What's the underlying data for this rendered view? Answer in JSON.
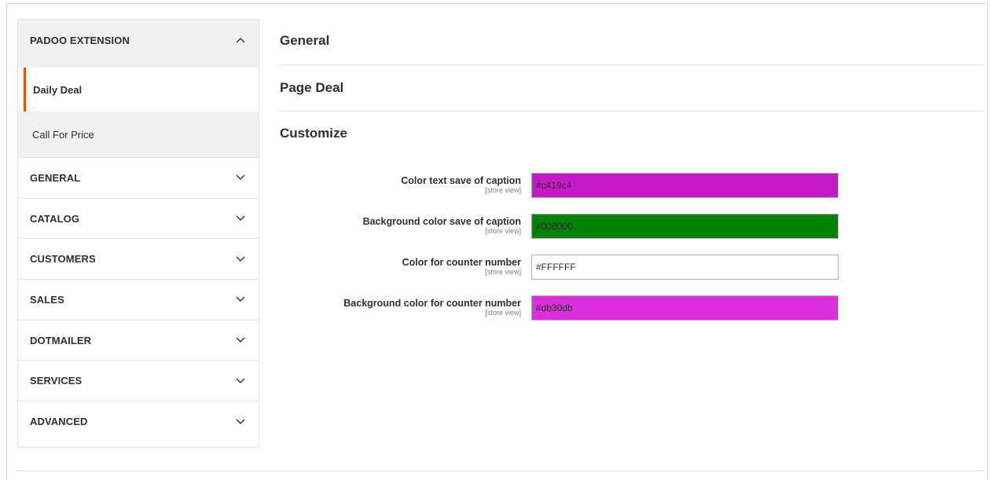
{
  "sidebar": {
    "extension": {
      "label": "PADOO EXTENSION",
      "items": [
        {
          "label": "Daily Deal"
        },
        {
          "label": "Call For Price"
        }
      ]
    },
    "groups": [
      {
        "label": "GENERAL"
      },
      {
        "label": "CATALOG"
      },
      {
        "label": "CUSTOMERS"
      },
      {
        "label": "SALES"
      },
      {
        "label": "DOTMAILER"
      },
      {
        "label": "SERVICES"
      },
      {
        "label": "ADVANCED"
      }
    ]
  },
  "main": {
    "sections": [
      {
        "title": "General"
      },
      {
        "title": "Page Deal"
      },
      {
        "title": "Customize"
      }
    ],
    "fields": [
      {
        "label": "Color text save of caption",
        "scope": "[store view]",
        "value": "#c419c4",
        "bg": "#c419c4"
      },
      {
        "label": "Background color save of caption",
        "scope": "[store view]",
        "value": "#008000",
        "bg": "#008000"
      },
      {
        "label": "Color for counter number",
        "scope": "[store view]",
        "value": "#FFFFFF",
        "bg": "#FFFFFF"
      },
      {
        "label": "Background color for counter number",
        "scope": "[store view]",
        "value": "#db30db",
        "bg": "#db30db"
      }
    ]
  },
  "colors": {
    "accent": "#eb5202",
    "sidebar_bg": "#f1f1f1",
    "border": "#e3e3e3"
  }
}
